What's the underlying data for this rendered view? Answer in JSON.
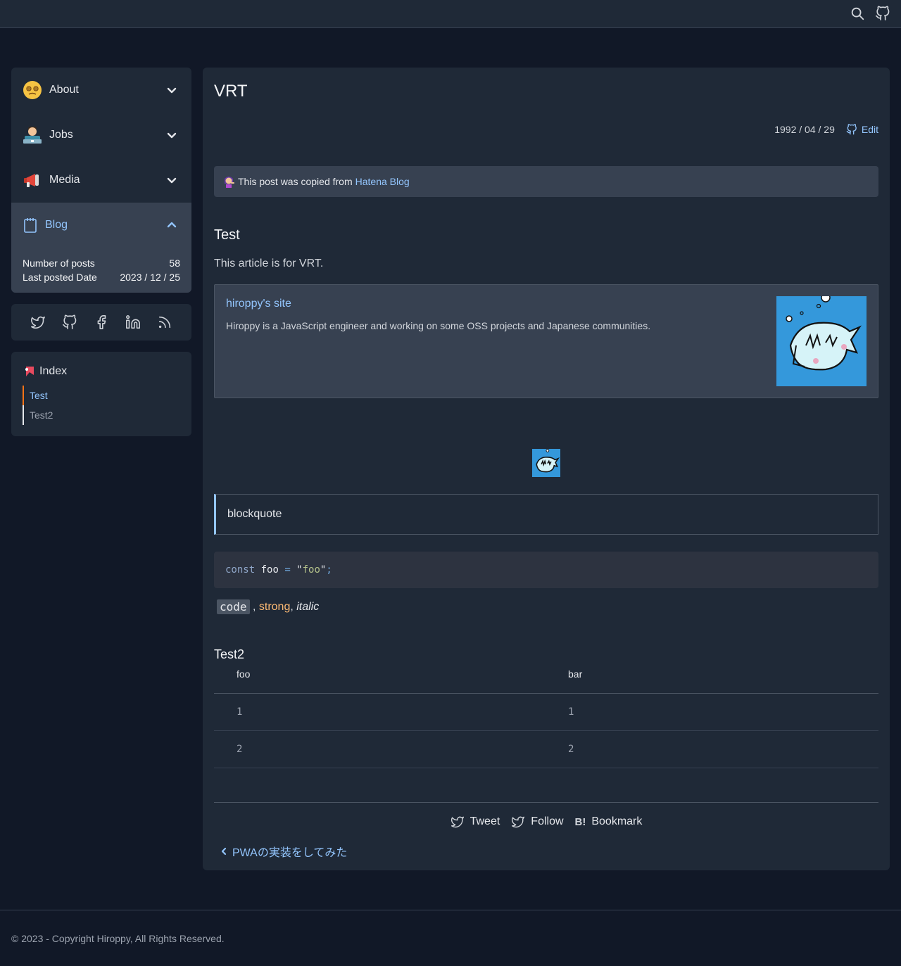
{
  "header": {
    "search_icon": "search-icon",
    "github_icon": "github-icon"
  },
  "sidebar": {
    "items": [
      {
        "label": "About",
        "icon": "face-with-spiral-eyes-emoji"
      },
      {
        "label": "Jobs",
        "icon": "technologist-emoji"
      },
      {
        "label": "Media",
        "icon": "megaphone-emoji"
      },
      {
        "label": "Blog",
        "icon": "notepad-icon",
        "active": true
      }
    ],
    "blog_stats": {
      "posts_label": "Number of posts",
      "posts_value": "58",
      "last_label": "Last posted Date",
      "last_value": "2023 / 12 / 25"
    },
    "social": [
      "twitter-icon",
      "github-icon",
      "facebook-icon",
      "linkedin-icon",
      "rss-icon"
    ],
    "index": {
      "title": "Index",
      "items": [
        "Test",
        "Test2"
      ]
    }
  },
  "article": {
    "title": "VRT",
    "date": "1992 / 04 / 29",
    "edit_label": "Edit",
    "notice_text": "This post was copied from",
    "notice_link": "Hatena Blog",
    "h_test": "Test",
    "paragraph": "This article is for VRT.",
    "linkcard": {
      "title": "hiroppy's site",
      "description": "Hiroppy is a JavaScript engineer and working on some OSS projects and Japanese communities."
    },
    "blockquote": "blockquote",
    "code": {
      "keyword": "const",
      "name": " foo ",
      "op": "=",
      "q1": " \"",
      "string": "foo",
      "q2": "\"",
      "semi": ";"
    },
    "inline": {
      "code": "code",
      "sep1": " , ",
      "strong": "strong",
      "sep2": ", ",
      "italic": "italic"
    },
    "h_test2": "Test2",
    "table": {
      "headers": [
        "foo",
        "bar"
      ],
      "rows": [
        [
          "1",
          "1"
        ],
        [
          "2",
          "2"
        ]
      ]
    },
    "share": {
      "tweet": "Tweet",
      "follow": "Follow",
      "bookmark_mark": "B!",
      "bookmark": "Bookmark"
    },
    "prev_link": "PWAの実装をしてみた"
  },
  "footer": {
    "copyright": "© 2023 - Copyright Hiroppy, All Rights Reserved."
  },
  "colors": {
    "bg": "#111827",
    "card": "#1f2937",
    "accent": "#93c5fd",
    "strong": "#fdba74",
    "index_marker": "#f97316"
  }
}
